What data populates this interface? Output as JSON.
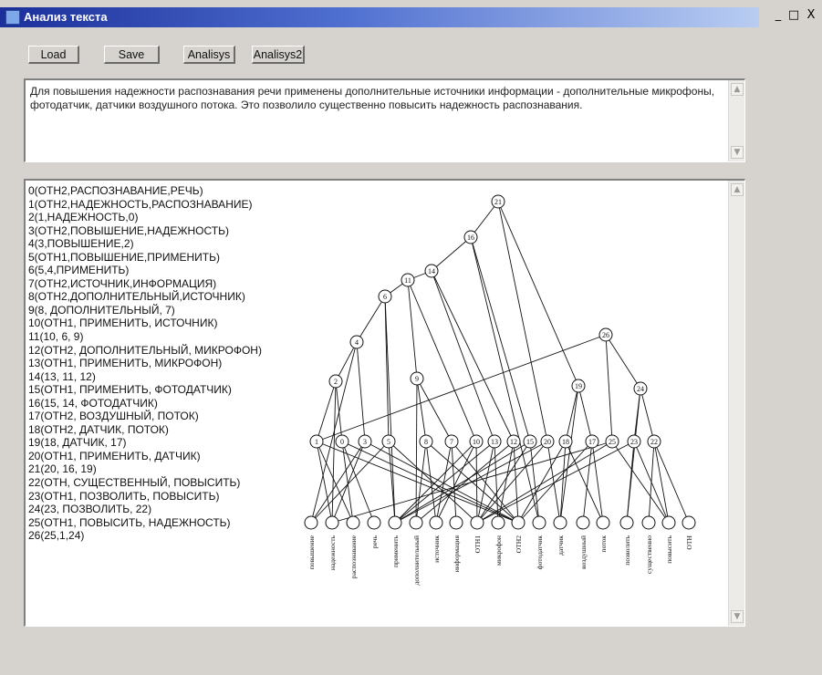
{
  "window": {
    "title": "Анализ текста",
    "minimize_glyph": "_",
    "maximize_glyph": "□",
    "close_glyph": "X"
  },
  "toolbar": {
    "load_label": "Load",
    "save_label": "Save",
    "analisys_label": "Analisys",
    "analisys2_label": "Analisys2"
  },
  "input": {
    "text": "Для повышения надежности распознавания речи применены дополнительные источники информации - дополнительные микрофоны, фотодатчик, датчики воздушного потока. Это позволило существенно повысить надежность распознавания."
  },
  "output": {
    "lines": [
      "0(ОТН2,РАСПОЗНАВАНИЕ,РЕЧЬ)",
      "1(ОТН2,НАДЕЖНОСТЬ,РАСПОЗНАВАНИЕ)",
      "2(1,НАДЕЖНОСТЬ,0)",
      "3(ОТН2,ПОВЫШЕНИЕ,НАДЕЖНОСТЬ)",
      "4(3,ПОВЫШЕНИЕ,2)",
      "5(ОТН1,ПОВЫШЕНИЕ,ПРИМЕНИТЬ)",
      "6(5,4,ПРИМЕНИТЬ)",
      "7(ОТН2,ИСТОЧНИК,ИНФОРМАЦИЯ)",
      "8(ОТН2,ДОПОЛНИТЕЛЬНЫЙ,ИСТОЧНИК)",
      "9(8, ДОПОЛНИТЕЛЬНЫЙ, 7)",
      "10(ОТН1, ПРИМЕНИТЬ, ИСТОЧНИК)",
      "11(10, 6, 9)",
      "12(ОТН2, ДОПОЛНИТЕЛЬНЫЙ, МИКРОФОН)",
      "13(ОТН1, ПРИМЕНИТЬ, МИКРОФОН)",
      "14(13, 11, 12)",
      "15(ОТН1, ПРИМЕНИТЬ, ФОТОДАТЧИК)",
      "16(15, 14, ФОТОДАТЧИК)",
      "17(ОТН2, ВОЗДУШНЫЙ, ПОТОК)",
      "18(ОТН2, ДАТЧИК, ПОТОК)",
      "19(18, ДАТЧИК, 17)",
      "20(ОТН1, ПРИМЕНИТЬ, ДАТЧИК)",
      "21(20, 16, 19)",
      "22(ОТН, СУЩЕСТВЕННЫЙ, ПОВЫСИТЬ)",
      "23(ОТН1, ПОЗВОЛИТЬ, ПОВЫСИТЬ)",
      "24(23, ПОЗВОЛИТЬ, 22)",
      "25(ОТН1, ПОВЫСИТЬ, НАДЕЖНОСТЬ)",
      "26(25,1,24)"
    ]
  },
  "graph": {
    "leaves": [
      "повышение",
      "надежность",
      "распознавание",
      "речь",
      "применить",
      "дополнительный",
      "источник",
      "информация",
      "ОТН1",
      "микрофон",
      "ОТН2",
      "фотодатчик",
      "датчик",
      "воздушный",
      "поток",
      "позволить",
      "существенно",
      "повысить",
      "ОТН"
    ],
    "node_labels": [
      "0",
      "1",
      "2",
      "3",
      "4",
      "5",
      "6",
      "7",
      "8",
      "9",
      "10",
      "11",
      "12",
      "13",
      "14",
      "15",
      "16",
      "17",
      "18",
      "19",
      "20",
      "21",
      "22",
      "23",
      "24",
      "25",
      "26"
    ],
    "edges": [
      [
        0,
        "L10"
      ],
      [
        0,
        "L2"
      ],
      [
        0,
        "L3"
      ],
      [
        1,
        "L10"
      ],
      [
        1,
        "L1"
      ],
      [
        1,
        "L2"
      ],
      [
        2,
        1
      ],
      [
        2,
        "L1"
      ],
      [
        2,
        0
      ],
      [
        3,
        "L10"
      ],
      [
        3,
        "L0"
      ],
      [
        3,
        "L1"
      ],
      [
        4,
        3
      ],
      [
        4,
        "L0"
      ],
      [
        4,
        2
      ],
      [
        5,
        "L8"
      ],
      [
        5,
        "L0"
      ],
      [
        5,
        "L4"
      ],
      [
        6,
        5
      ],
      [
        6,
        4
      ],
      [
        6,
        "L4"
      ],
      [
        7,
        "L10"
      ],
      [
        7,
        "L6"
      ],
      [
        7,
        "L7"
      ],
      [
        8,
        "L10"
      ],
      [
        8,
        "L5"
      ],
      [
        8,
        "L6"
      ],
      [
        9,
        8
      ],
      [
        9,
        "L5"
      ],
      [
        9,
        7
      ],
      [
        10,
        "L8"
      ],
      [
        10,
        "L4"
      ],
      [
        10,
        "L6"
      ],
      [
        11,
        10
      ],
      [
        11,
        6
      ],
      [
        11,
        9
      ],
      [
        12,
        "L10"
      ],
      [
        12,
        "L5"
      ],
      [
        12,
        "L9"
      ],
      [
        13,
        "L8"
      ],
      [
        13,
        "L4"
      ],
      [
        13,
        "L9"
      ],
      [
        14,
        13
      ],
      [
        14,
        11
      ],
      [
        14,
        12
      ],
      [
        15,
        "L8"
      ],
      [
        15,
        "L4"
      ],
      [
        15,
        "L11"
      ],
      [
        16,
        15
      ],
      [
        16,
        14
      ],
      [
        16,
        "L11"
      ],
      [
        17,
        "L10"
      ],
      [
        17,
        "L13"
      ],
      [
        17,
        "L14"
      ],
      [
        18,
        "L10"
      ],
      [
        18,
        "L12"
      ],
      [
        18,
        "L14"
      ],
      [
        19,
        18
      ],
      [
        19,
        "L12"
      ],
      [
        19,
        17
      ],
      [
        20,
        "L8"
      ],
      [
        20,
        "L4"
      ],
      [
        20,
        "L12"
      ],
      [
        21,
        20
      ],
      [
        21,
        16
      ],
      [
        21,
        19
      ],
      [
        22,
        "L18"
      ],
      [
        22,
        "L16"
      ],
      [
        22,
        "L17"
      ],
      [
        23,
        "L8"
      ],
      [
        23,
        "L15"
      ],
      [
        23,
        "L17"
      ],
      [
        24,
        23
      ],
      [
        24,
        "L15"
      ],
      [
        24,
        22
      ],
      [
        25,
        "L8"
      ],
      [
        25,
        "L17"
      ],
      [
        25,
        "L1"
      ],
      [
        26,
        25
      ],
      [
        26,
        1
      ],
      [
        26,
        24
      ]
    ]
  },
  "colors": {
    "titlebar_start": "#1b2f9a",
    "titlebar_end": "#b9cdf2",
    "window_bg": "#d6d3ce",
    "field_bg": "#ffffff"
  }
}
